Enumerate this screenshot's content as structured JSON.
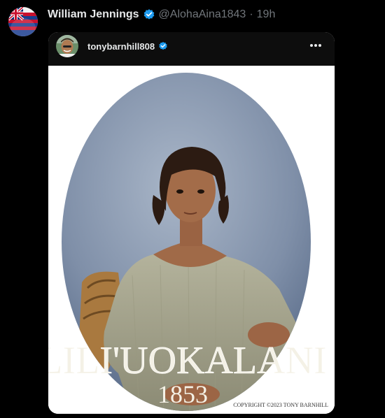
{
  "post": {
    "author_name": "William Jennings",
    "author_handle": "@AlohaAina1843",
    "separator": "·",
    "timestamp": "19h"
  },
  "embed": {
    "username": "tonybarnhill808",
    "image": {
      "title_text": "LILI'UOKALANI",
      "year_text": "1853",
      "copyright_text": "COPYRIGHT ©2023 TONY BARNHILL"
    }
  },
  "icons": {
    "verified": "verified-badge-icon",
    "more": "more-dots-icon",
    "avatar_main": "hawaii-flag-avatar",
    "avatar_small": "profile-photo-avatar"
  },
  "colors": {
    "background": "#000000",
    "verified_blue": "#1d9bf0",
    "secondary_text": "#71767b",
    "primary_text": "#e7e9ea"
  }
}
